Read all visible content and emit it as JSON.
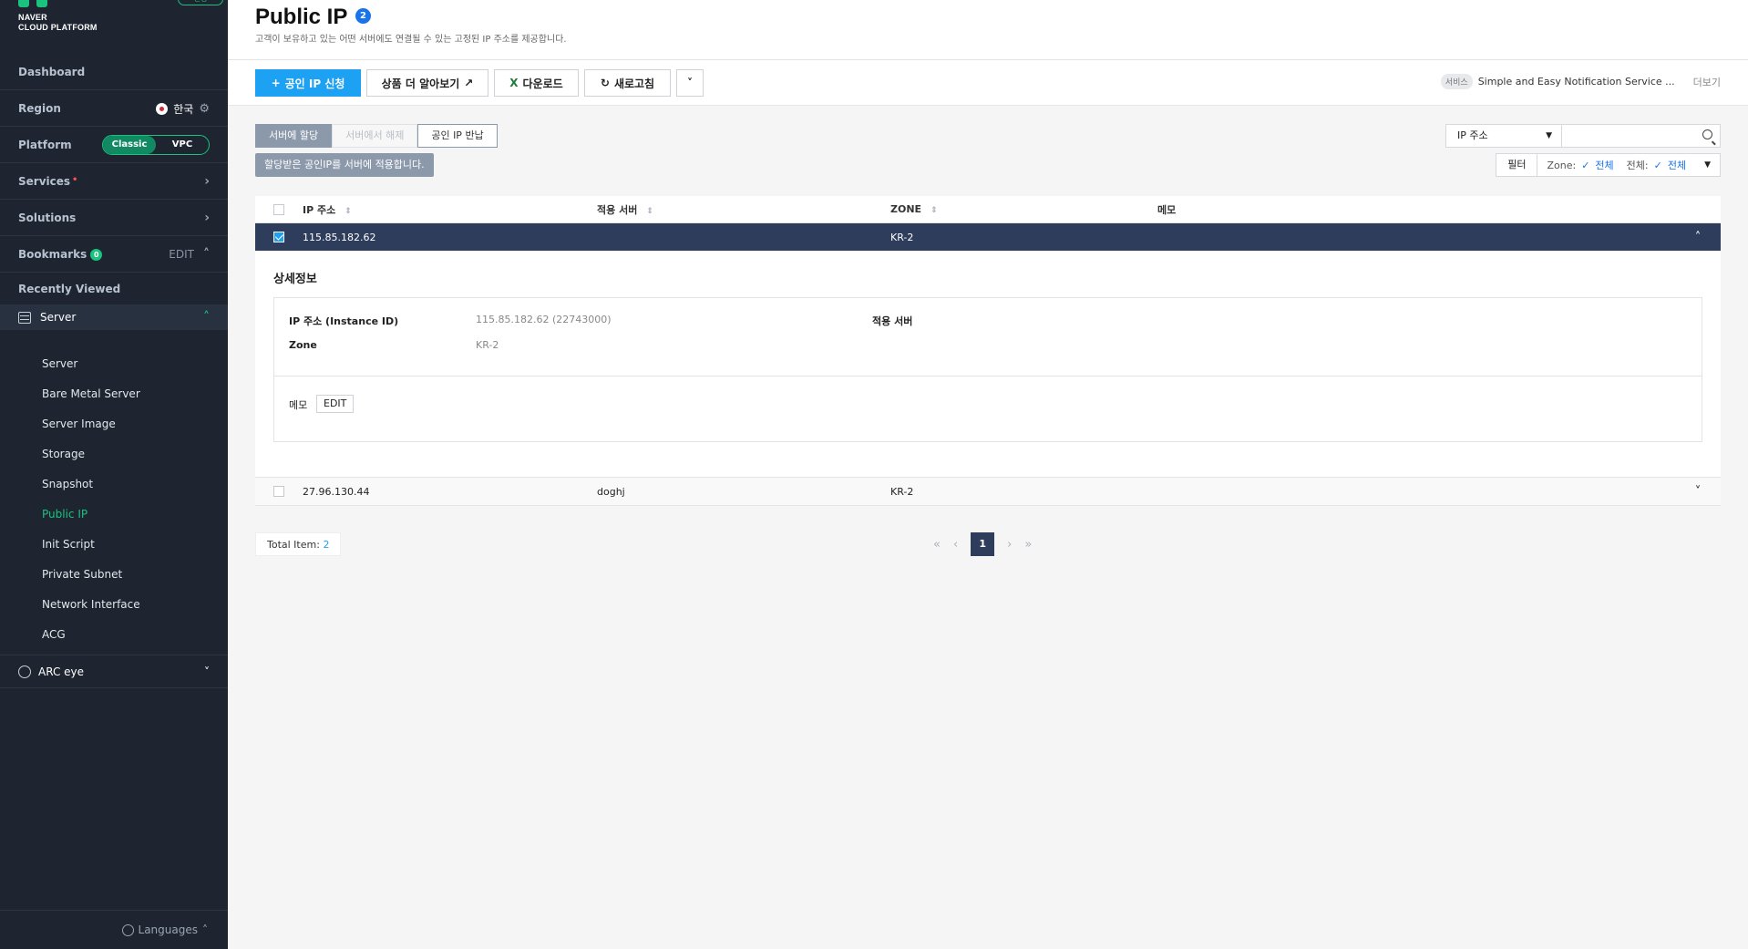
{
  "sidebar": {
    "brand_line1": "NAVER",
    "brand_line2": "CLOUD PLATFORM",
    "brand_badge": "신청",
    "dashboard": "Dashboard",
    "region_label": "Region",
    "region_value": "한국",
    "platform_label": "Platform",
    "platform_options": [
      "Classic",
      "VPC"
    ],
    "platform_selected": "Classic",
    "services": "Services",
    "solutions": "Solutions",
    "bookmarks": "Bookmarks",
    "bookmarks_count": "0",
    "bookmarks_edit": "EDIT",
    "recently_viewed": "Recently Viewed",
    "server_group": "Server",
    "server_items": [
      "Server",
      "Bare Metal Server",
      "Server Image",
      "Storage",
      "Snapshot",
      "Public IP",
      "Init Script",
      "Private Subnet",
      "Network Interface",
      "ACG"
    ],
    "active_item": "Public IP",
    "arc_eye": "ARC eye",
    "languages": "Languages"
  },
  "header": {
    "title": "Public IP",
    "count": "2",
    "subtitle": "고객이 보유하고 있는 어떤 서버에도 연결될 수 있는 고정된 IP 주소를 제공합니다."
  },
  "toolbar": {
    "apply_ip": "공인 IP 신청",
    "learn_more": "상품 더 알아보기",
    "download": "다운로드",
    "refresh": "새로고침",
    "service_pill": "서비스",
    "service_name": "Simple and Easy Notification Service ...",
    "more": "더보기"
  },
  "actions": {
    "assign": "서버에 할당",
    "unassign": "서버에서 해제",
    "return": "공인 IP 반납",
    "tooltip": "할당받은 공인IP를 서버에 적용합니다."
  },
  "search": {
    "field": "IP 주소",
    "filter": "필터",
    "zone_label": "Zone:",
    "zone_value": "전체",
    "all_label": "전체:",
    "all_value": "전체"
  },
  "table": {
    "headers": [
      "IP 주소",
      "적용 서버",
      "ZONE",
      "메모"
    ],
    "rows": [
      {
        "ip": "115.85.182.62",
        "server": "",
        "zone": "KR-2",
        "memo": "",
        "selected": true
      },
      {
        "ip": "27.96.130.44",
        "server": "doghj",
        "zone": "KR-2",
        "memo": "",
        "selected": false
      }
    ]
  },
  "detail": {
    "title": "상세정보",
    "ip_label": "IP 주소 (Instance ID)",
    "ip_value": "115.85.182.62 (22743000)",
    "server_label": "적용 서버",
    "zone_label": "Zone",
    "zone_value": "KR-2",
    "memo_label": "메모",
    "memo_edit": "EDIT"
  },
  "footer": {
    "total_label": "Total Item:",
    "total_value": "2",
    "current_page": "1"
  }
}
